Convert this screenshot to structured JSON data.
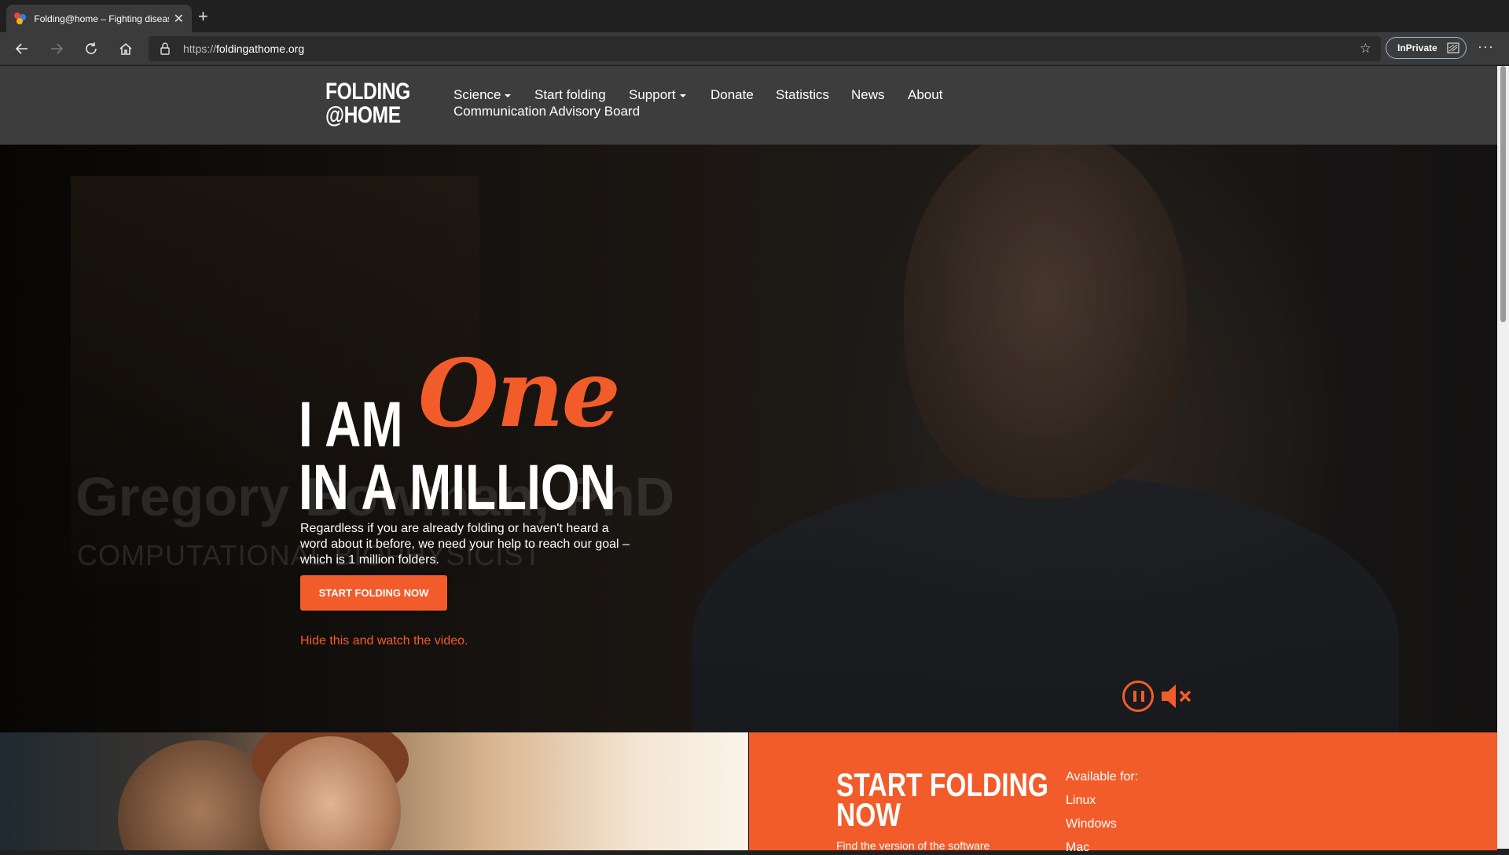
{
  "browser": {
    "tab_title": "Folding@home – Fighting disease",
    "url_scheme": "https://",
    "url_host": "foldingathome.org",
    "inprivate_label": "InPrivate"
  },
  "site": {
    "logo_line1": "FOLDING",
    "logo_line2": "@HOME",
    "nav": {
      "science": "Science",
      "start_folding": "Start folding",
      "support": "Support",
      "donate": "Donate",
      "statistics": "Statistics",
      "news": "News",
      "about": "About",
      "advisory_board": "Communication Advisory Board"
    }
  },
  "hero": {
    "headline_i_am": "I AM",
    "headline_one": "One",
    "headline_million": "IN A MILLION",
    "intro": "Regardless if you are already folding or haven't heard a word about it before, we need your help to reach our goal – which is 1 million folders.",
    "cta_label": "START FOLDING NOW",
    "hide_link": "Hide this and watch the video.",
    "ghost_name": "Gregory Bowman, PhD",
    "ghost_title": "COMPUTATIONAL BIOPHYSICIST"
  },
  "start_section": {
    "title": "START FOLDING NOW",
    "description": "Find the version of the software",
    "available_label": "Available for:",
    "platforms": [
      "Linux",
      "Windows",
      "Mac"
    ]
  },
  "colors": {
    "accent": "#f25c2a",
    "header_bg": "#3d3d3d"
  }
}
